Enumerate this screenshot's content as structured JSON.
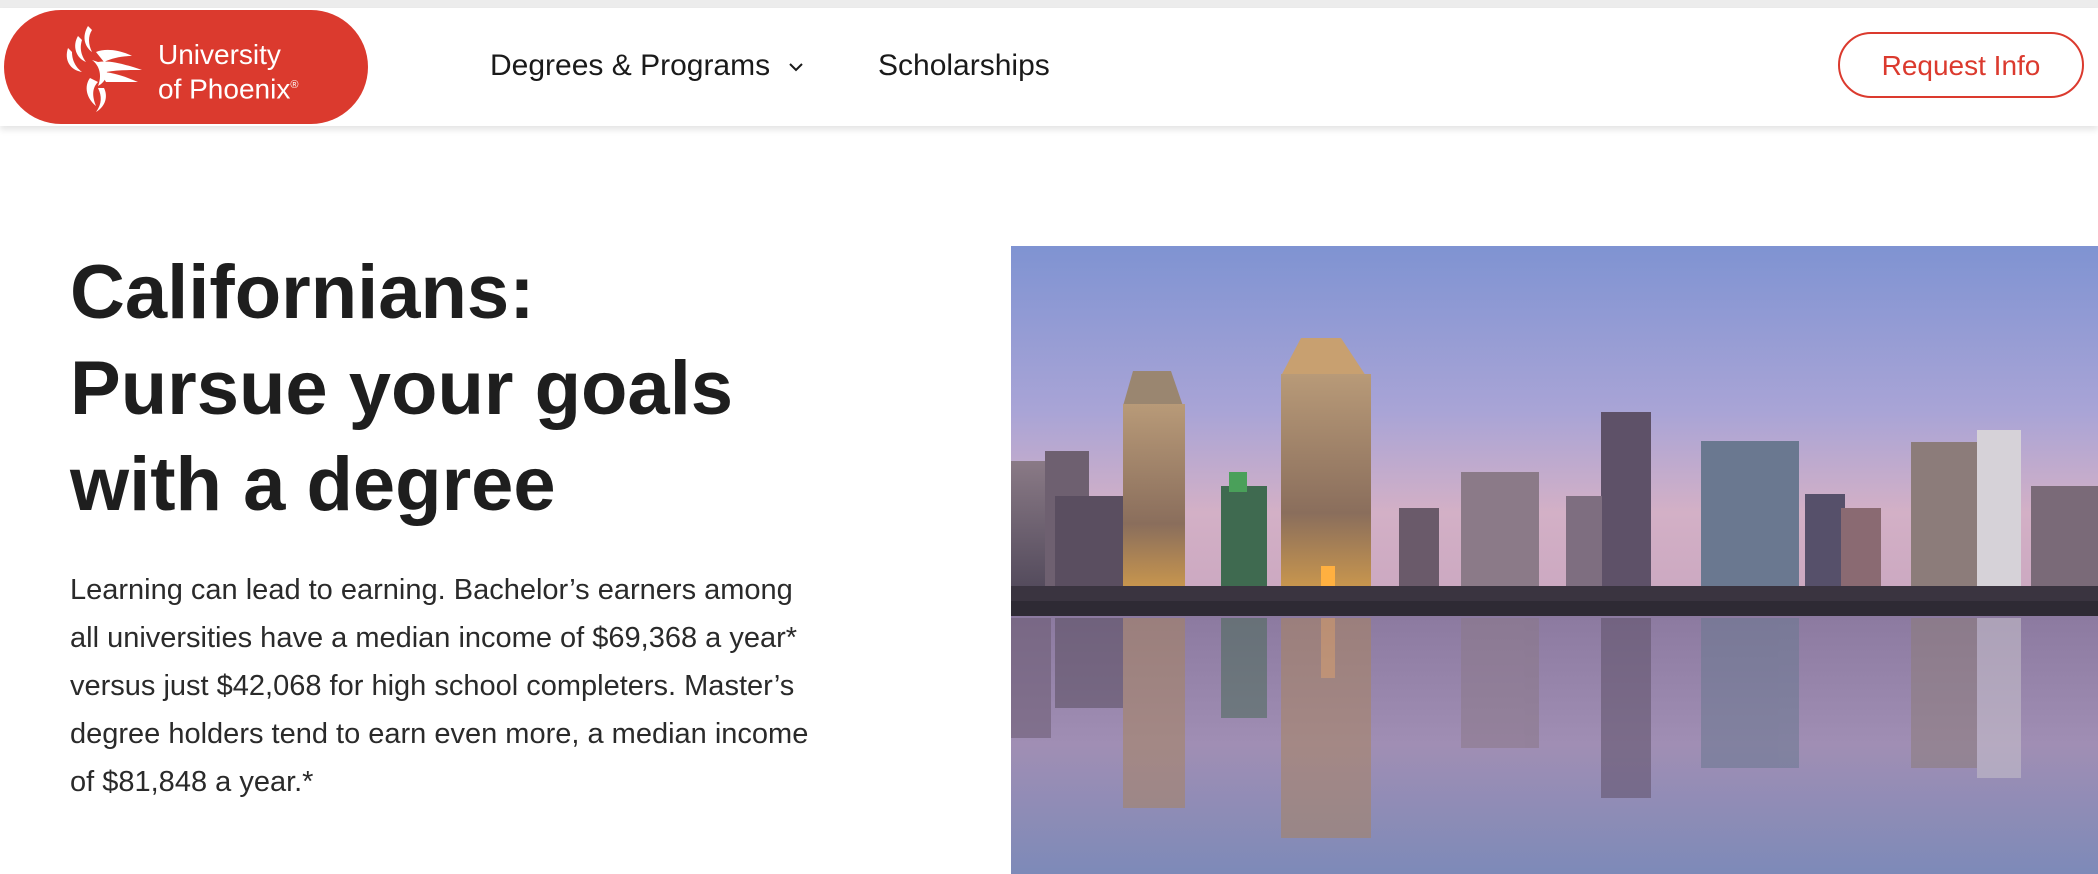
{
  "brand": {
    "name_line1": "University",
    "name_line2": "of Phoenix",
    "registered_mark": "®",
    "color": "#db3a2e"
  },
  "nav": {
    "items": [
      {
        "label": "Degrees & Programs",
        "has_dropdown": true,
        "icon": "chevron-down-icon"
      },
      {
        "label": "Scholarships"
      }
    ],
    "cta_label": "Request Info"
  },
  "hero": {
    "headline_lines": [
      "Californians:",
      "Pursue your goals",
      "with a degree"
    ],
    "body": "Learning can lead to earning. Bachelor’s earners among all universities have a median income of $69,368 a year* versus just $42,068 for high school completers. Master’s degree holders tend to earn even more, a median income of $81,848 a year.*",
    "image": "city-skyline-waterfront-image"
  }
}
